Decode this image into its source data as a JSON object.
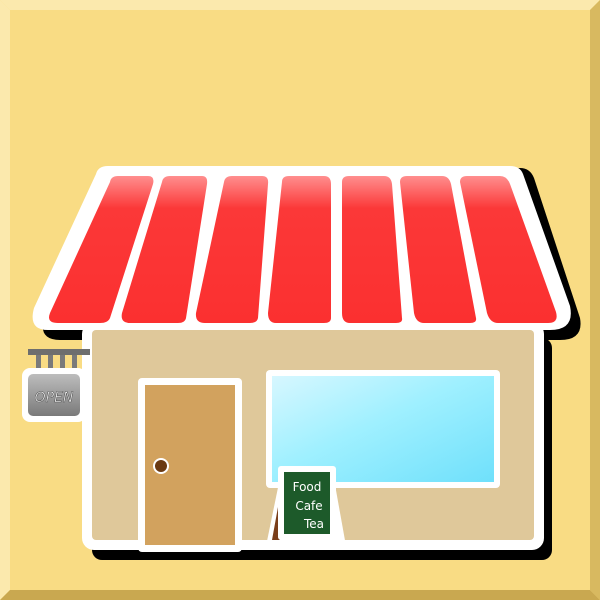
{
  "colors": {
    "background": "#f9dc84",
    "frame_light": "#fbe7a6",
    "frame_dark": "#d2b35a",
    "awning_red": "#fb3535",
    "awning_highlight": "#ff9a9a",
    "wall": "#dfc89a",
    "outline": "#ffffff",
    "shadow": "#000000",
    "door": "#d2a25e",
    "window": "#8fe8ff",
    "sign_board": "#1d5a2a",
    "sign_frame": "#7a3e1a",
    "open_sign": "#9a9a9a"
  },
  "shop": {
    "open_sign_text": "OPEN",
    "board_lines": [
      "Food",
      "Cafe",
      "Tea"
    ]
  },
  "icons": {
    "shop": "shop-building-icon",
    "open_sign": "hanging-open-sign-icon",
    "board": "sandwich-board-sign-icon"
  }
}
